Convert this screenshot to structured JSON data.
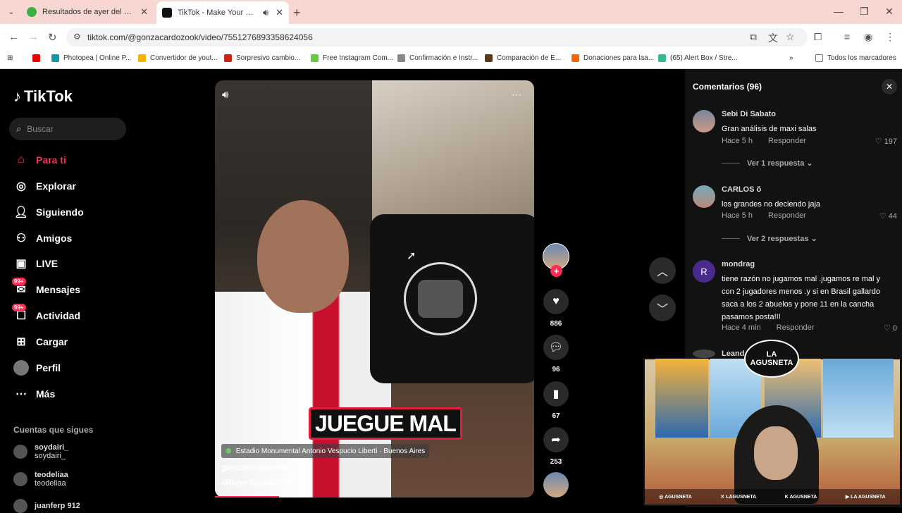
{
  "browser": {
    "tabs": [
      {
        "title": "Resultados de ayer del Futbol A",
        "active": false
      },
      {
        "title": "TikTok - Make Your Day",
        "active": true
      }
    ],
    "url": "tiktok.com/@gonzacardozook/video/7551276893358624056",
    "bookmarks": [
      "Photopea | Online P...",
      "Convertidor de yout...",
      "Sorpresivo cambio...",
      "Free Instagram Com...",
      "Confirmación e Instr...",
      "Comparación de E...",
      "Donaciones para laa...",
      "(65) Alert Box / Stre..."
    ],
    "all_bookmarks": "Todos los marcadores"
  },
  "sidebar": {
    "logo": "TikTok",
    "search_placeholder": "Buscar",
    "nav": [
      {
        "label": "Para ti",
        "icon": "home-icon",
        "active": true
      },
      {
        "label": "Explorar",
        "icon": "compass-icon"
      },
      {
        "label": "Siguiendo",
        "icon": "following-icon"
      },
      {
        "label": "Amigos",
        "icon": "friends-icon"
      },
      {
        "label": "LIVE",
        "icon": "live-icon"
      },
      {
        "label": "Mensajes",
        "icon": "messages-icon",
        "badge": "99+"
      },
      {
        "label": "Actividad",
        "icon": "activity-icon",
        "badge": "99+"
      },
      {
        "label": "Cargar",
        "icon": "upload-icon"
      },
      {
        "label": "Perfil",
        "icon": "profile-icon"
      },
      {
        "label": "Más",
        "icon": "more-icon"
      }
    ],
    "following_title": "Cuentas que sigues",
    "following": [
      {
        "name": "soydairi_",
        "sub": "soydairi_"
      },
      {
        "name": "teodeliaa",
        "sub": "teodeliaa"
      },
      {
        "name": "juanferp 912",
        "sub": ""
      }
    ]
  },
  "video": {
    "caption_overlay": "JUEGUE MAL",
    "location": "Estadio Monumental Antonio Vespucio Liberti · Buenos Aires",
    "author": "gonzacardozook",
    "hashtags": "#River  #palmeiras",
    "likes": "886",
    "comments": "96",
    "saves": "67",
    "shares": "253",
    "progress": 0.2
  },
  "comments": {
    "title": "Comentarios (96)",
    "reply_label": "Responder",
    "items": [
      {
        "user": "Sebi Di Sabato",
        "text": "Gran análisis de maxi salas",
        "time": "Hace 5 h",
        "likes": "197",
        "replies": "Ver 1 respuesta"
      },
      {
        "user": "CARLOS ŏ",
        "text": "los grandes no deciendo jaja",
        "time": "Hace 5 h",
        "likes": "44",
        "replies": "Ver 2 respuestas"
      },
      {
        "user": "mondrag",
        "text": "tiene razón no jugamos mal .jugamos re mal y con 2 jugadores menos .y si en Brasil gallardo saca a los 2 abuelos y pone 11 en la cancha pasamos posta!!!",
        "time": "Hace 4 min",
        "likes": "0",
        "avatar_letter": "R"
      },
      {
        "user": "Leand",
        "text": ""
      }
    ]
  },
  "webcam": {
    "logo_line1": "LA",
    "logo_line2": "AGUSNETA",
    "socials": [
      "AGUSNETA",
      "LAGUSNETA",
      "AGUSNETA",
      "LA AGUSNETA"
    ]
  },
  "colors": {
    "accent": "#fe2c55",
    "tab_bar": "#f8d7d3"
  }
}
